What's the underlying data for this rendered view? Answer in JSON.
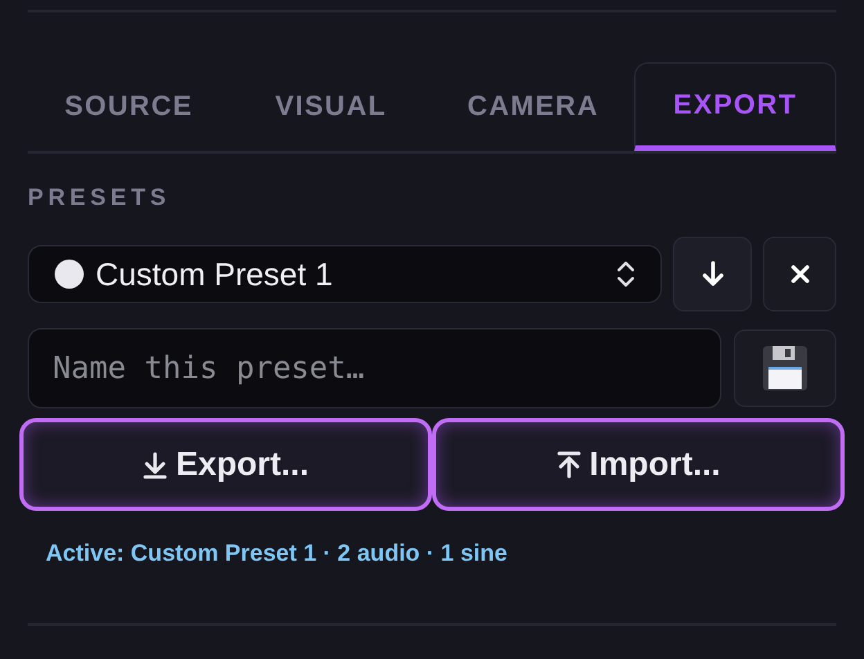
{
  "tabs": [
    {
      "label": "SOURCE",
      "selected": false
    },
    {
      "label": "VISUAL",
      "selected": false
    },
    {
      "label": "CAMERA",
      "selected": false
    },
    {
      "label": "EXPORT",
      "selected": true
    }
  ],
  "presets": {
    "heading": "PRESETS",
    "select_value": "Custom Preset 1",
    "name_field": {
      "placeholder": "Name this preset…"
    },
    "actions": [
      {
        "kind": "export",
        "label": "Export..."
      },
      {
        "kind": "import",
        "label": "Import..."
      }
    ],
    "status": "Active: Custom Preset 1 · 2 audio · 1 sine"
  }
}
